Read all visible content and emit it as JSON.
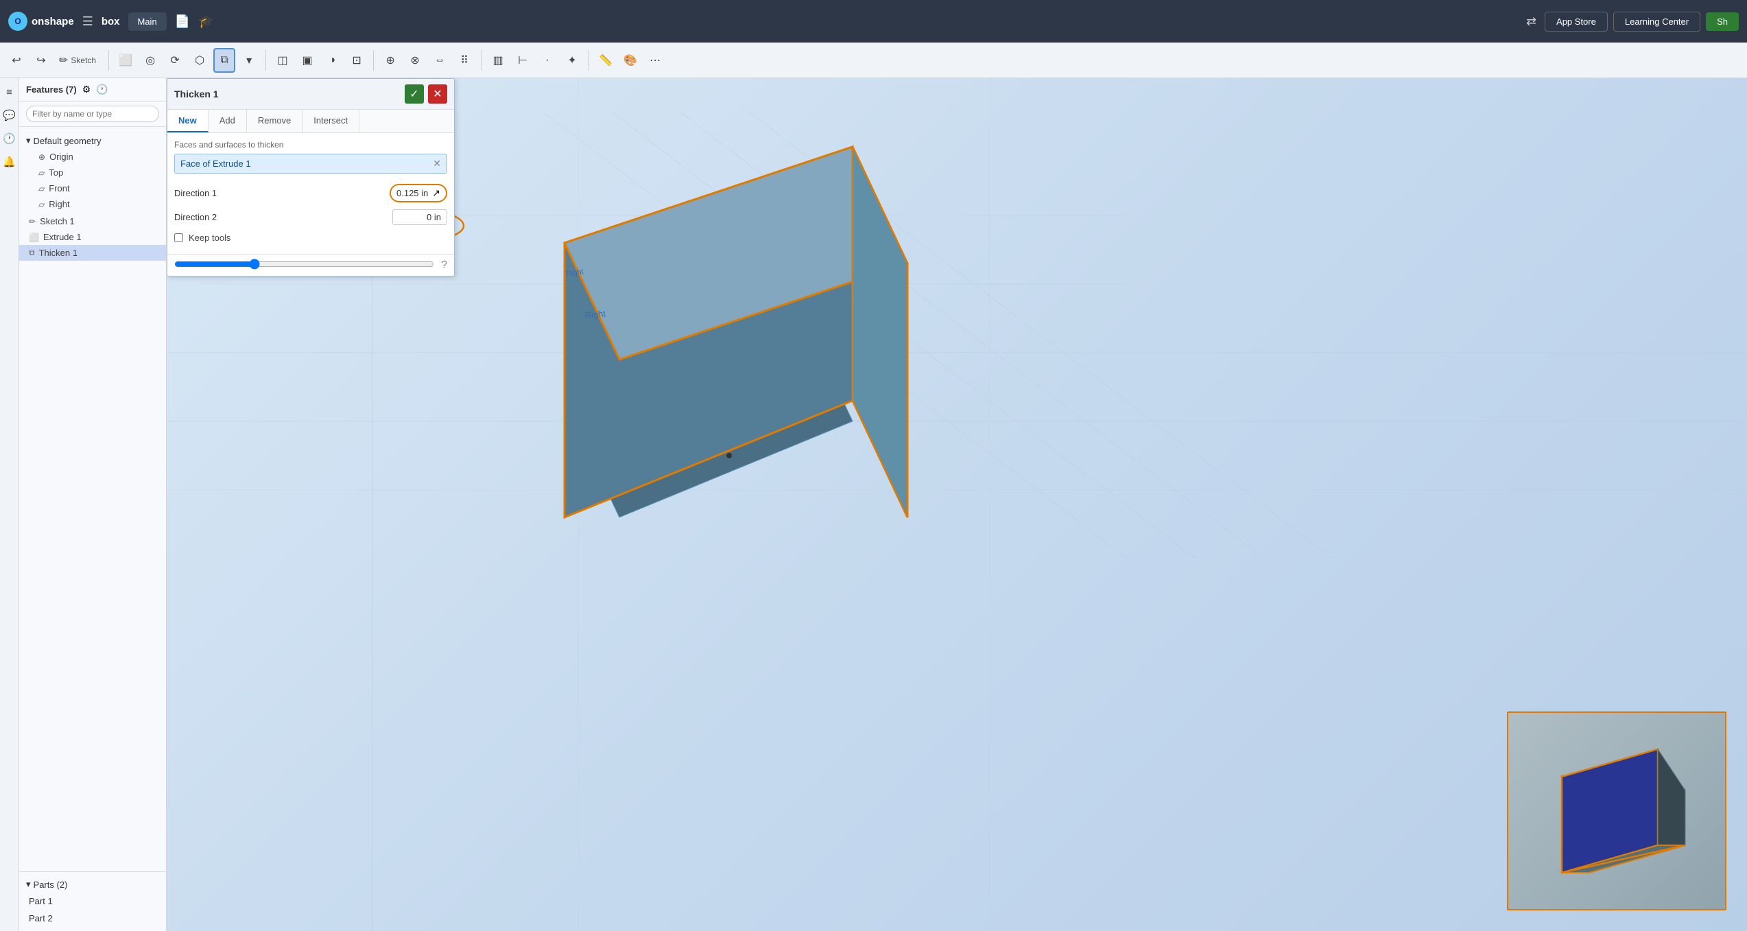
{
  "app": {
    "logo_text": "onshape",
    "doc_name": "box",
    "tab_main": "Main"
  },
  "topbar": {
    "app_store_label": "App Store",
    "learning_center_label": "Learning Center",
    "start_label": "Sh"
  },
  "toolbar": {
    "sketch_label": "Sketch",
    "items": [
      "↩",
      "↪",
      "✏",
      "⊞",
      "◎",
      "⬟",
      "☐",
      "⬡",
      "◫",
      "▣",
      "⊡",
      "▤",
      "◑",
      "⊕",
      "⊗",
      "⬤",
      "⊞"
    ]
  },
  "sidebar": {
    "features_label": "Features (7)",
    "filter_placeholder": "Filter by name or type",
    "default_geometry_label": "Default geometry",
    "origin_label": "Origin",
    "top_label": "Top",
    "front_label": "Front",
    "right_label": "Right",
    "sketch1_label": "Sketch 1",
    "extrude1_label": "Extrude 1",
    "thicken1_label": "Thicken 1",
    "parts_label": "Parts (2)",
    "part1_label": "Part 1",
    "part2_label": "Part 2"
  },
  "thicken_panel": {
    "title": "Thicken 1",
    "tabs": [
      "New",
      "Add",
      "Remove",
      "Intersect"
    ],
    "active_tab": "New",
    "faces_label": "Faces and surfaces to thicken",
    "face_chip": "Face of Extrude 1",
    "direction1_label": "Direction 1",
    "direction1_value": "0.125 in",
    "direction2_label": "Direction 2",
    "direction2_value": "0 in",
    "keep_tools_label": "Keep tools"
  },
  "viewport": {
    "right_label": "Right"
  },
  "inset": {
    "border_color": "#e07b00"
  },
  "colors": {
    "accent_orange": "#e07b00",
    "accent_blue": "#1a6bbf",
    "box_top": "#7fb8d8",
    "box_front": "#4a6f85",
    "box_side": "#5a8098",
    "box_outline": "#e07b00",
    "grid_color": "#a8c0d8"
  }
}
